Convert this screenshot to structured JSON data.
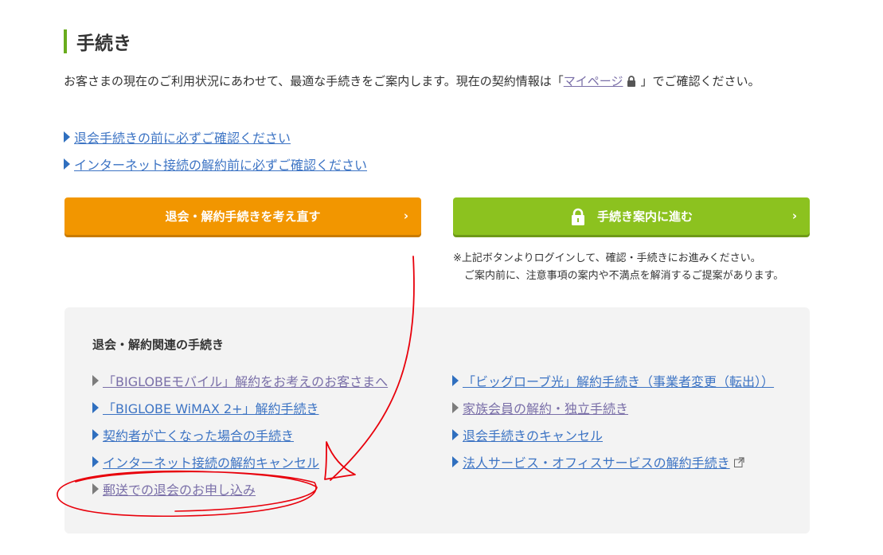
{
  "section": {
    "title": "手続き"
  },
  "intro": {
    "text_before": "お客さまの現在のご利用状況にあわせて、最適な手続きをご案内します。現在の契約情報は「",
    "link_label": "マイページ",
    "text_after": "」でご確認ください。"
  },
  "top_links": [
    {
      "label": "退会手続きの前に必ずご確認ください"
    },
    {
      "label": "インターネット接続の解約前に必ずご確認ください"
    }
  ],
  "buttons": {
    "reconsider": "退会・解約手続きを考え直す",
    "proceed": "手続き案内に進む"
  },
  "note": {
    "line1": "※上記ボタンよりログインして、確認・手続きにお進みください。",
    "line2": "ご案内前に、注意事項の案内や不満点を解消するご提案があります。"
  },
  "panel": {
    "title": "退会・解約関連の手続き",
    "left_links": [
      {
        "label": "「BIGLOBEモバイル」解約をお考えのお客さまへ",
        "style": "gray"
      },
      {
        "label": "「BIGLOBE WiMAX 2+」解約手続き",
        "style": "blue"
      },
      {
        "label": "契約者が亡くなった場合の手続き",
        "style": "blue"
      },
      {
        "label": "インターネット接続の解約キャンセル",
        "style": "blue"
      },
      {
        "label": "郵送での退会のお申し込み",
        "style": "gray"
      }
    ],
    "right_links": [
      {
        "label": "「ビッグローブ光」解約手続き（事業者変更（転出））",
        "style": "blue"
      },
      {
        "label": "家族会員の解約・独立手続き",
        "style": "gray"
      },
      {
        "label": "退会手続きのキャンセル",
        "style": "blue"
      },
      {
        "label": "法人サービス・オフィスサービスの解約手続き",
        "style": "blue",
        "external": true
      }
    ]
  },
  "colors": {
    "accent_green": "#69ac1d",
    "button_orange": "#f29600",
    "button_green": "#8cc21f",
    "link_blue": "#3d74c4",
    "link_visited": "#7a6fa8",
    "annotation_red": "#e8000b"
  },
  "icons": [
    "lock-icon",
    "chevron-right-icon",
    "triangle-bullet-icon",
    "external-link-icon"
  ]
}
